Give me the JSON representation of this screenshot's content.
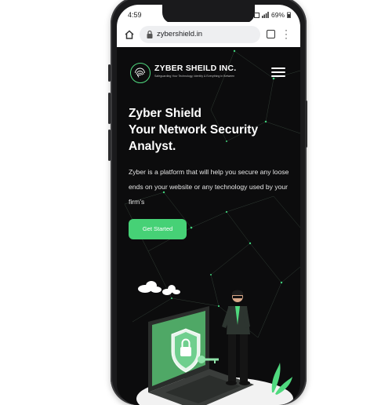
{
  "status_bar": {
    "time": "4:59",
    "battery": "69%"
  },
  "browser": {
    "url": "zybershield.in"
  },
  "site": {
    "brand_name": "ZYBER SHEILD INC.",
    "tagline": "Safeguarding Your Technology, Identity & Everything in Between",
    "hero_title_line1": "Zyber Shield",
    "hero_title_line2": "Your Network Security",
    "hero_title_line3": "Analyst.",
    "hero_description": "Zyber is a platform that will help you secure any loose ends on your website or any technology used by your firm's",
    "cta_label": "Get Started"
  },
  "colors": {
    "accent": "#46d176",
    "background": "#0c0c0d"
  }
}
